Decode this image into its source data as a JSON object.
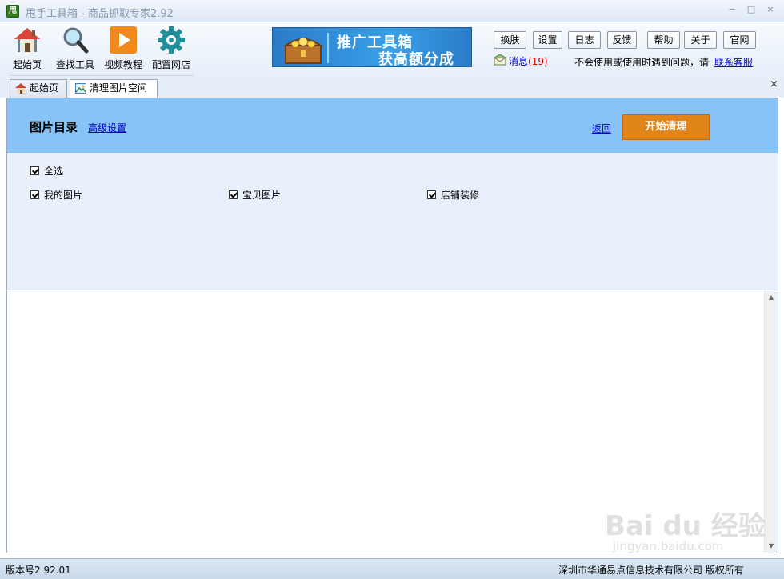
{
  "window": {
    "app_icon_text": "甩",
    "title": "甩手工具箱 - 商品抓取专家2.92",
    "min": "−",
    "max": "□",
    "close": "×"
  },
  "toolbar": {
    "items": [
      {
        "label": "起始页",
        "icon": "home-icon"
      },
      {
        "label": "查找工具",
        "icon": "magnifier-icon"
      },
      {
        "label": "视频教程",
        "icon": "play-icon"
      },
      {
        "label": "配置网店",
        "icon": "gear-icon"
      }
    ],
    "banner": {
      "line1": "推广工具箱",
      "line2": "获高额分成",
      "icon": "treasure-chest-icon"
    },
    "buttons": {
      "skin": "换肤",
      "settings": "设置",
      "log": "日志",
      "feedback": "反馈",
      "help": "帮助",
      "about": "关于",
      "website": "官网"
    },
    "messages": {
      "label": "消息",
      "count": "(19)"
    },
    "help_text": "不会使用或使用时遇到问题，请",
    "contact_link": "联系客服"
  },
  "tabs": [
    {
      "label": "起始页",
      "icon": "home-icon",
      "active": false
    },
    {
      "label": "清理图片空间",
      "icon": "picture-icon",
      "active": true
    }
  ],
  "tab_close": "×",
  "panel": {
    "title": "图片目录",
    "advanced_link": "高级设置",
    "back_link": "返回",
    "start_button": "开始清理",
    "options": {
      "select_all": {
        "label": "全选",
        "checked": true
      },
      "my_images": {
        "label": "我的图片",
        "checked": true
      },
      "item_images": {
        "label": "宝贝图片",
        "checked": true
      },
      "store_decoration": {
        "label": "店铺装修",
        "checked": true
      }
    }
  },
  "watermark": {
    "text": "Bai du 经验",
    "sub": "jingyan.baidu.com"
  },
  "statusbar": {
    "version": "版本号2.92.01",
    "copyright": "深圳市华通易点信息技术有限公司 版权所有"
  },
  "colors": {
    "header_blue": "#87c3f6",
    "start_orange": "#e1841a",
    "options_bg": "#eaf0fb",
    "link_blue": "#0000cc"
  }
}
